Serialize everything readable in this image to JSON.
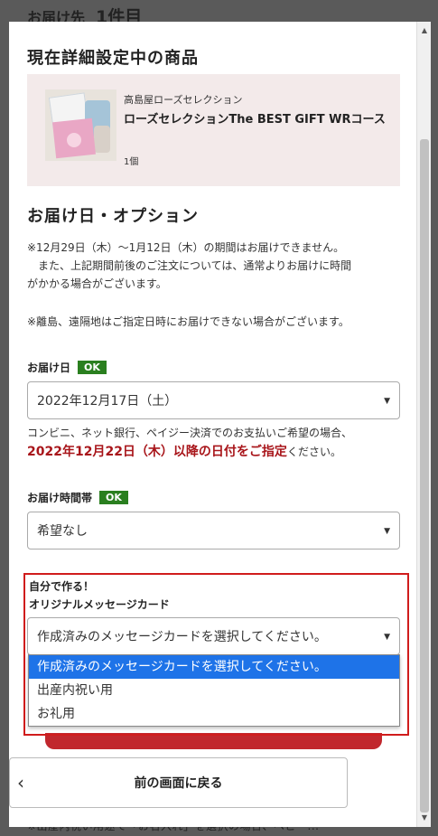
{
  "background": {
    "title": "お届け先",
    "count": "1件目",
    "bottom_text": "※出産内祝い用途で「お名入れ」を選択の場合、ベビー..."
  },
  "product_section": {
    "title": "現在詳細設定中の商品",
    "brand": "高島屋ローズセレクション",
    "name": "ローズセレクションThe BEST GIFT WRコース",
    "qty": "1個"
  },
  "delivery_section": {
    "title": "お届け日・オプション",
    "notice1": "※12月29日（木）～1月12日（木）の期間はお届けできません。\n　また、上記期間前後のご注文については、通常よりお届けに時間\nがかかる場合がございます。",
    "notice2": "※離島、遠隔地はご指定日時にお届けできない場合がございます。"
  },
  "delivery_date": {
    "label": "お届け日",
    "badge": "OK",
    "value": "2022年12月17日（土）",
    "hint_line1": "コンビニ、ネット銀行、ペイジー決済でのお支払いご希望の場合、",
    "hint_red": "2022年12月22日（木）以降の日付をご指定",
    "hint_tail": "ください。"
  },
  "delivery_time": {
    "label": "お届け時間帯",
    "badge": "OK",
    "value": "希望なし"
  },
  "message_card": {
    "title_line1": "自分で作る！",
    "title_line2": "オリジナルメッセージカード",
    "value": "作成済みのメッセージカードを選択してください。",
    "options": [
      "作成済みのメッセージカードを選択してください。",
      "出産内祝い用",
      "お礼用"
    ]
  },
  "back_button": {
    "label": "前の画面に戻る"
  },
  "colors": {
    "ok_badge": "#2a7f1f",
    "highlight_red": "#a8151a",
    "frame_red": "#d01c1c",
    "selected_blue": "#1e73e8",
    "card_bg": "#f3eaea"
  }
}
